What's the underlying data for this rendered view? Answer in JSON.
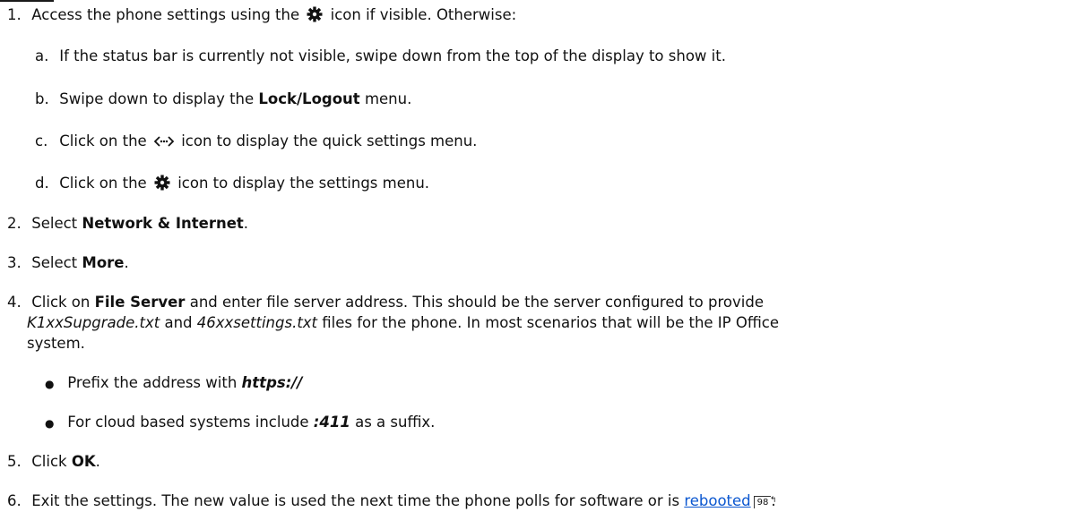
{
  "steps": {
    "s1": {
      "num": "1.",
      "text_a": "Access the phone settings using the",
      "icon": "gear-icon",
      "text_b": "icon if visible. Otherwise:"
    },
    "s1a": {
      "num": "a.",
      "text": "If the status bar is currently not visible, swipe down from the top of the display to show it."
    },
    "s1b": {
      "num": "b.",
      "text_a": "Swipe down to display the",
      "bold": "Lock/Logout",
      "text_b": "menu."
    },
    "s1c": {
      "num": "c.",
      "text_a": "Click on the",
      "icon": "quick-settings-icon",
      "text_b": "icon to display the quick settings menu."
    },
    "s1d": {
      "num": "d.",
      "text_a": "Click on the",
      "icon": "gear-icon",
      "text_b": "icon to display the settings menu."
    },
    "s2": {
      "num": "2.",
      "text_a": "Select",
      "bold": "Network & Internet",
      "text_b": "."
    },
    "s3": {
      "num": "3.",
      "text_a": "Select",
      "bold": "More",
      "text_b": "."
    },
    "s4": {
      "num": "4.",
      "text_a": "Click on",
      "bold": "File Server",
      "text_b": "and enter file server address. This should be the server configured to provide",
      "file1": "K1xxSupgrade.txt",
      "and": "and",
      "file2": "46xxsettings.txt",
      "text_c": "files for the phone. In most scenarios that will be the IP Office",
      "text_d": "system."
    },
    "s4_bullets": [
      {
        "text_a": "Prefix the address with",
        "emph": "https://",
        "text_b": ""
      },
      {
        "text_a": "For cloud based systems include",
        "emph": ":411",
        "text_b": "as a suffix."
      }
    ],
    "s5": {
      "num": "5.",
      "text_a": "Click",
      "bold": "OK",
      "text_b": "."
    },
    "s6": {
      "num": "6.",
      "text_a": "Exit the settings. The new value is used the next time the phone polls for software or is",
      "link": "rebooted",
      "ref": "98",
      "text_b": "."
    }
  }
}
